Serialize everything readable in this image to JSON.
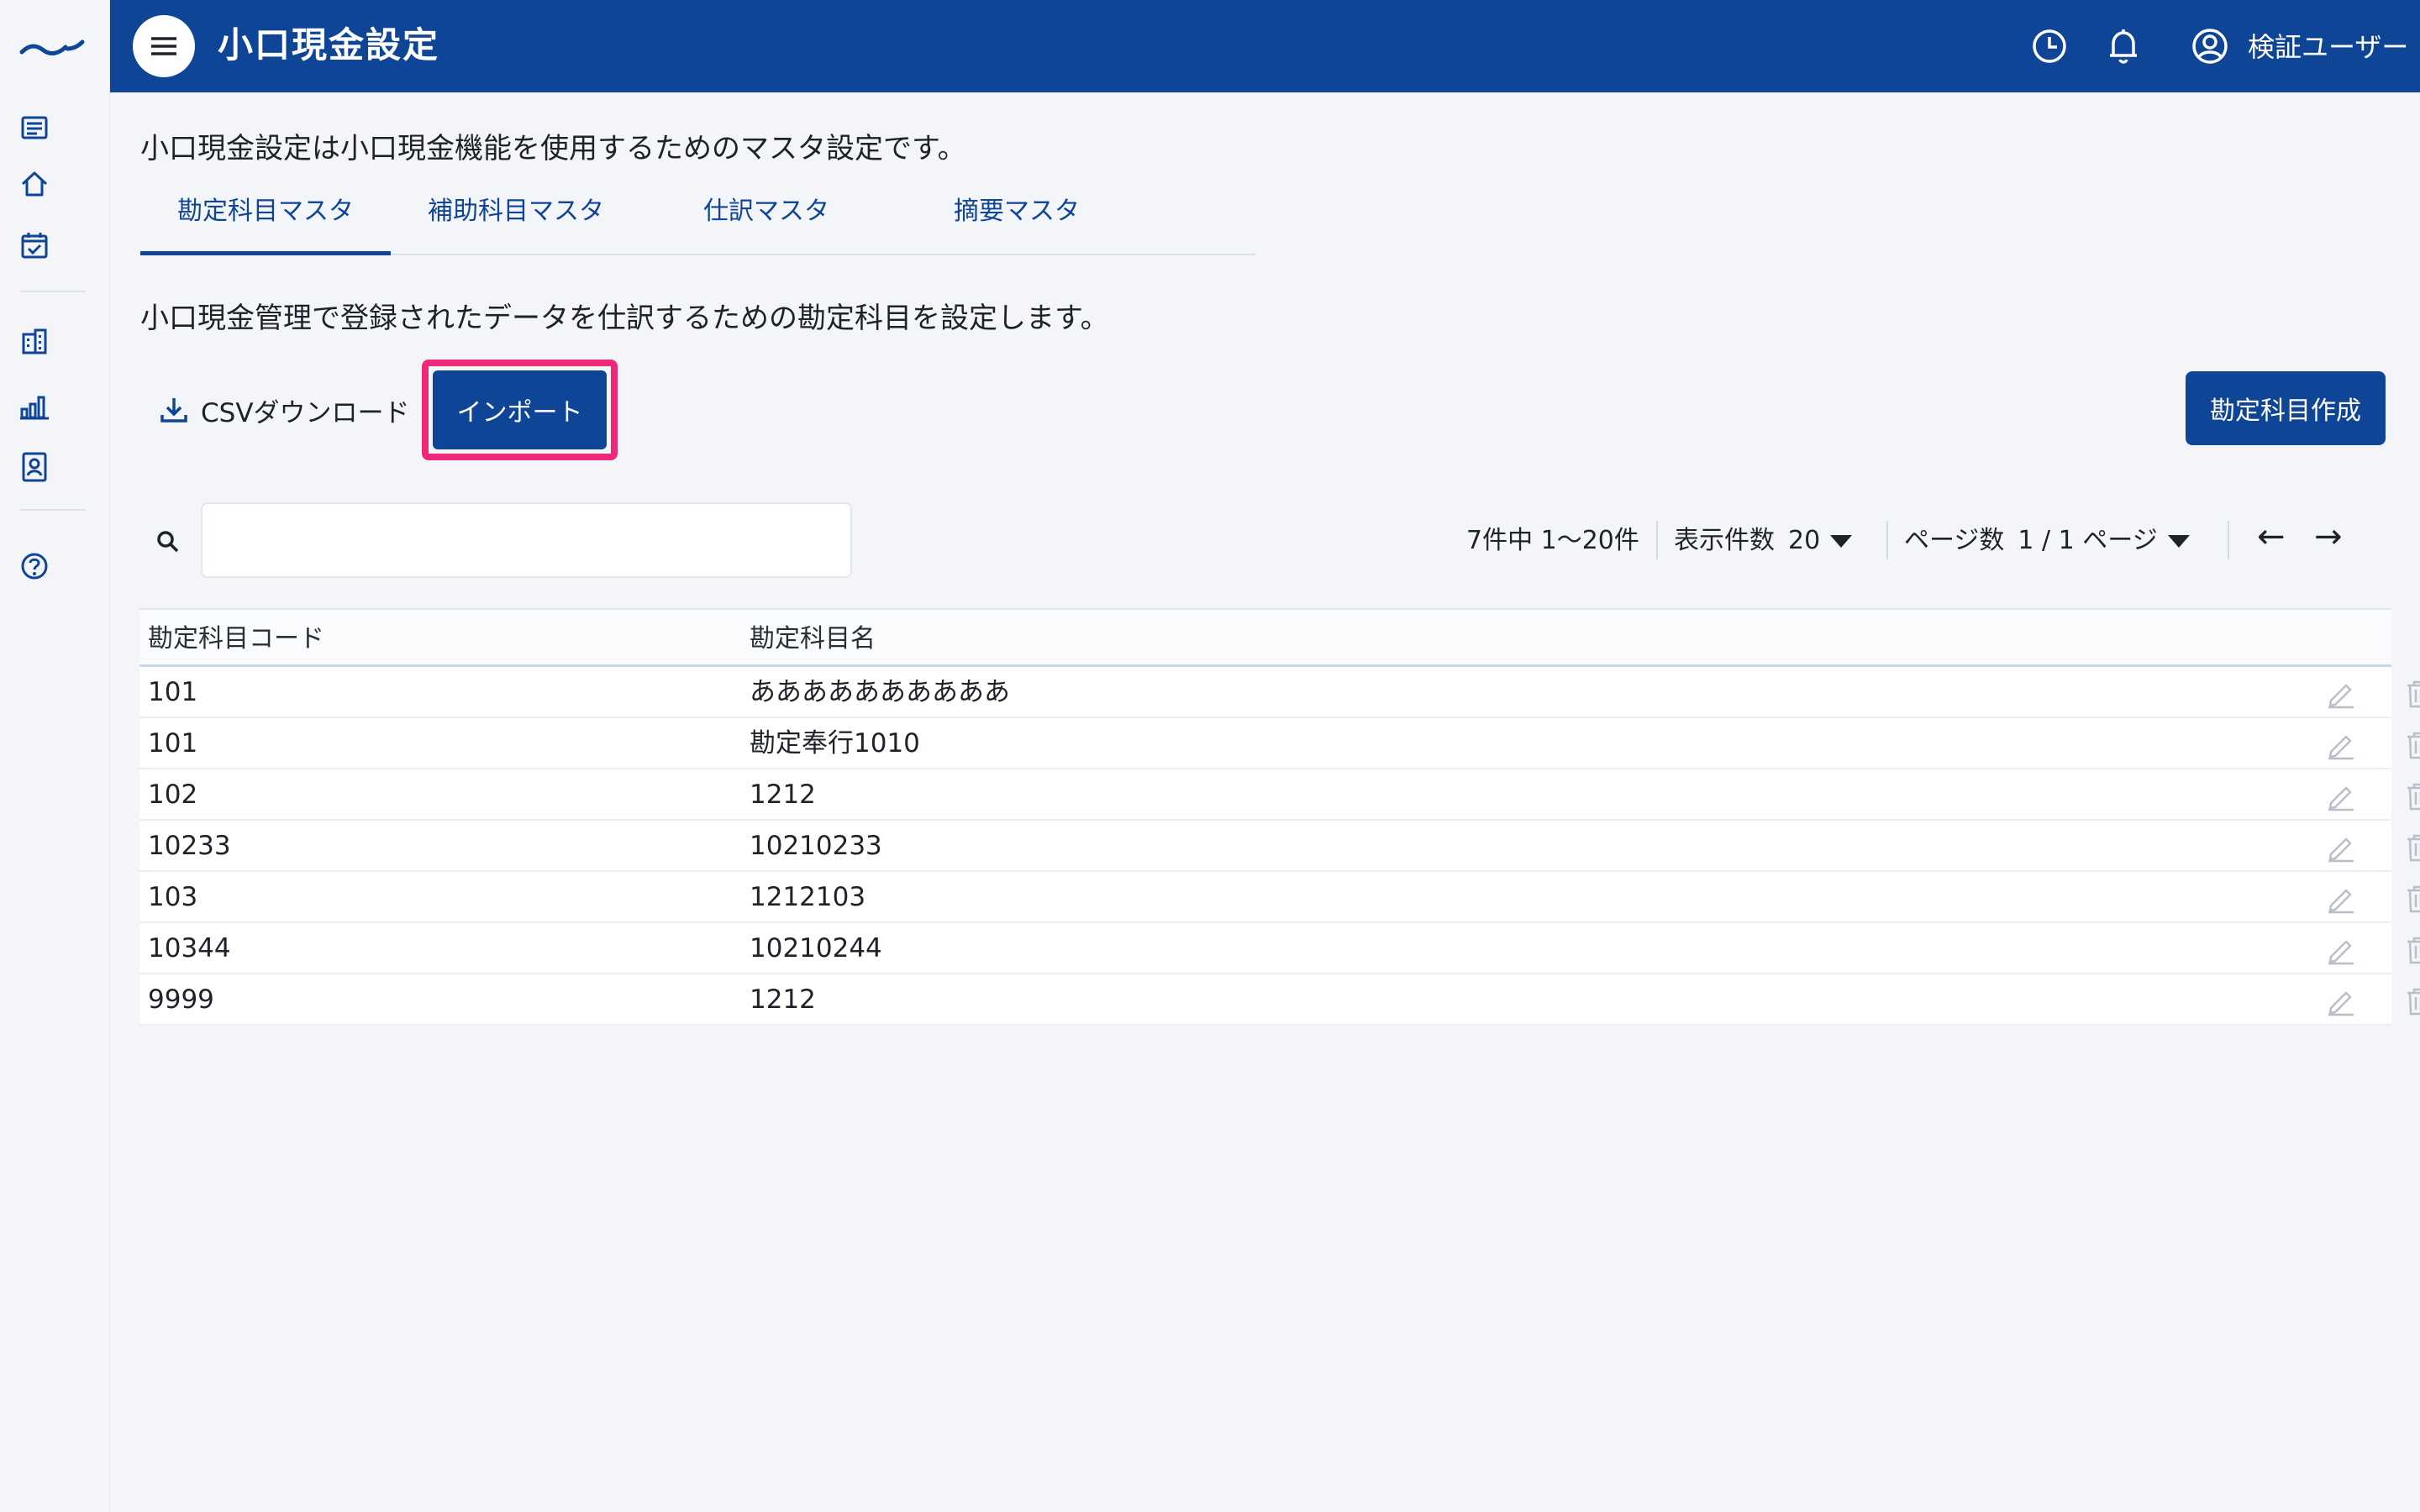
{
  "header": {
    "title": "小口現金設定",
    "user_name": "検証ユーザー",
    "brand_color": "#0e4596"
  },
  "main": {
    "intro": "小口現金設定は小口現金機能を使用するためのマスタ設定です。",
    "tabs": [
      {
        "label": "勘定科目マスタ",
        "active": true
      },
      {
        "label": "補助科目マスタ",
        "active": false
      },
      {
        "label": "仕訳マスタ",
        "active": false
      },
      {
        "label": "摘要マスタ",
        "active": false
      }
    ],
    "description": "小口現金管理で登録されたデータを仕訳するための勘定科目を設定します。",
    "toolbar": {
      "csv_label": "CSVダウンロード",
      "import_label": "インポート",
      "create_label": "勘定科目作成",
      "highlight_color": "#f0287a"
    },
    "search": {
      "placeholder": "",
      "value": ""
    },
    "pager": {
      "range_text": "7件中 1〜20件",
      "per_page_label": "表示件数",
      "per_page_value": "20",
      "page_label": "ページ数",
      "page_value": "1 / 1 ページ",
      "prev": "←",
      "next": "→"
    },
    "table": {
      "columns": [
        "勘定科目コード",
        "勘定科目名"
      ],
      "rows": [
        {
          "code": "101",
          "name": "ああああああああああ"
        },
        {
          "code": "101",
          "name": "勘定奉行1010"
        },
        {
          "code": "102",
          "name": "1212"
        },
        {
          "code": "10233",
          "name": "10210233"
        },
        {
          "code": "103",
          "name": "1212103"
        },
        {
          "code": "10344",
          "name": "10210244"
        },
        {
          "code": "9999",
          "name": "1212"
        }
      ]
    }
  },
  "icons": [
    "logo-icon",
    "list-icon",
    "home-icon",
    "calendar-check-icon",
    "building-icon",
    "bar-chart-icon",
    "contact-card-icon",
    "help-icon",
    "menu-icon",
    "clock-icon",
    "bell-icon",
    "user-circle-icon",
    "download-icon",
    "search-icon",
    "edit-icon",
    "trash-icon"
  ]
}
